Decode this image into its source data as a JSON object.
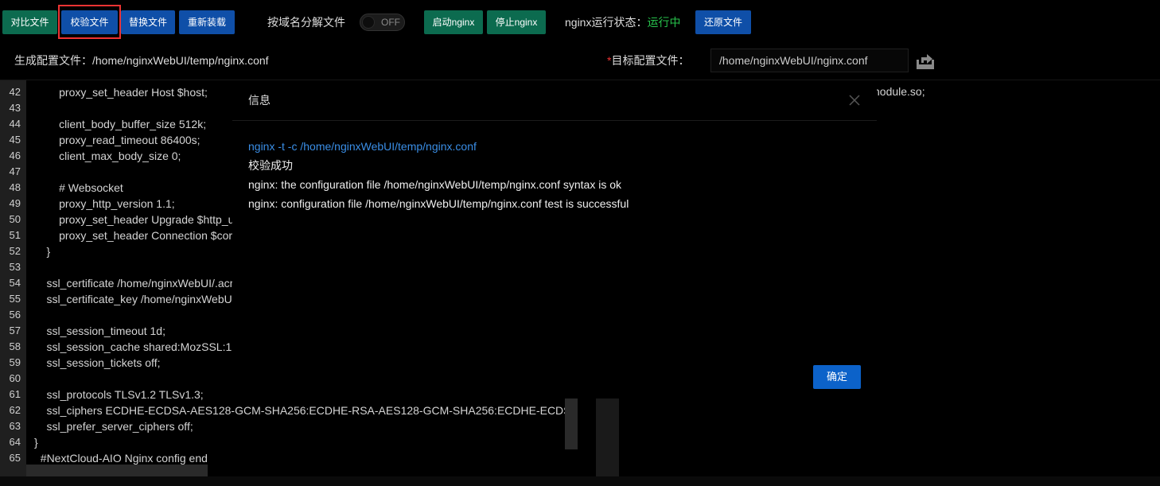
{
  "toolbar": {
    "compare_label": "对比文件",
    "verify_label": "校验文件",
    "replace_label": "替换文件",
    "reload_label": "重新装载",
    "split_by_domain_label": "按域名分解文件",
    "split_switch_text": "OFF",
    "start_label": "启动nginx",
    "stop_label": "停止nginx",
    "status_label": "nginx运行状态：",
    "status_value": "运行中",
    "restore_label": "还原文件"
  },
  "colors": {
    "green_button": "#0c6b4f",
    "blue_button": "#0f4fa8",
    "status_running": "#27c24c",
    "highlight_border": "#ee3333",
    "command_text": "#3a8ee6",
    "confirm_button": "#0c62c9"
  },
  "paths": {
    "generated_label": "生成配置文件：",
    "generated_value": "/home/nginxWebUI/temp/nginx.conf",
    "target_required_mark": "*",
    "target_label": "目标配置文件：",
    "target_value": "/home/nginxWebUI/nginx.conf",
    "upload_icon": "upload-icon"
  },
  "editor": {
    "lines": [
      {
        "n": "42",
        "code": "        proxy_set_header Host $host;"
      },
      {
        "n": "43",
        "code": ""
      },
      {
        "n": "44",
        "code": "        client_body_buffer_size 512k;"
      },
      {
        "n": "45",
        "code": "        proxy_read_timeout 86400s;"
      },
      {
        "n": "46",
        "code": "        client_max_body_size 0;"
      },
      {
        "n": "47",
        "code": ""
      },
      {
        "n": "48",
        "code": "        # Websocket"
      },
      {
        "n": "49",
        "code": "        proxy_http_version 1.1;"
      },
      {
        "n": "50",
        "code": "        proxy_set_header Upgrade $http_u"
      },
      {
        "n": "51",
        "code": "        proxy_set_header Connection $cor"
      },
      {
        "n": "52",
        "code": "    }"
      },
      {
        "n": "53",
        "code": ""
      },
      {
        "n": "54",
        "code": "    ssl_certificate /home/nginxWebUI/.acr"
      },
      {
        "n": "55",
        "code": "    ssl_certificate_key /home/nginxWebU"
      },
      {
        "n": "56",
        "code": ""
      },
      {
        "n": "57",
        "code": "    ssl_session_timeout 1d;"
      },
      {
        "n": "58",
        "code": "    ssl_session_cache shared:MozSSL:1"
      },
      {
        "n": "59",
        "code": "    ssl_session_tickets off;"
      },
      {
        "n": "60",
        "code": ""
      },
      {
        "n": "61",
        "code": "    ssl_protocols TLSv1.2 TLSv1.3;"
      },
      {
        "n": "62",
        "code": "    ssl_ciphers ECDHE-ECDSA-AES128-GCM-SHA256:ECDHE-RSA-AES128-GCM-SHA256:ECDHE-ECDS"
      },
      {
        "n": "63",
        "code": "    ssl_prefer_server_ciphers off;"
      },
      {
        "n": "64",
        "code": "}"
      },
      {
        "n": "65",
        "code": "  #NextCloud-AIO Nginx config end"
      }
    ]
  },
  "right_pane": {
    "visible_text": "nodule.so;"
  },
  "modal": {
    "title": "信息",
    "close_icon": "close-icon",
    "command": "nginx -t -c /home/nginxWebUI/temp/nginx.conf",
    "result": "校验成功",
    "output_line_1": "nginx: the configuration file /home/nginxWebUI/temp/nginx.conf syntax is ok",
    "output_line_2": "nginx: configuration file /home/nginxWebUI/temp/nginx.conf test is successful",
    "confirm_label": "确定"
  }
}
